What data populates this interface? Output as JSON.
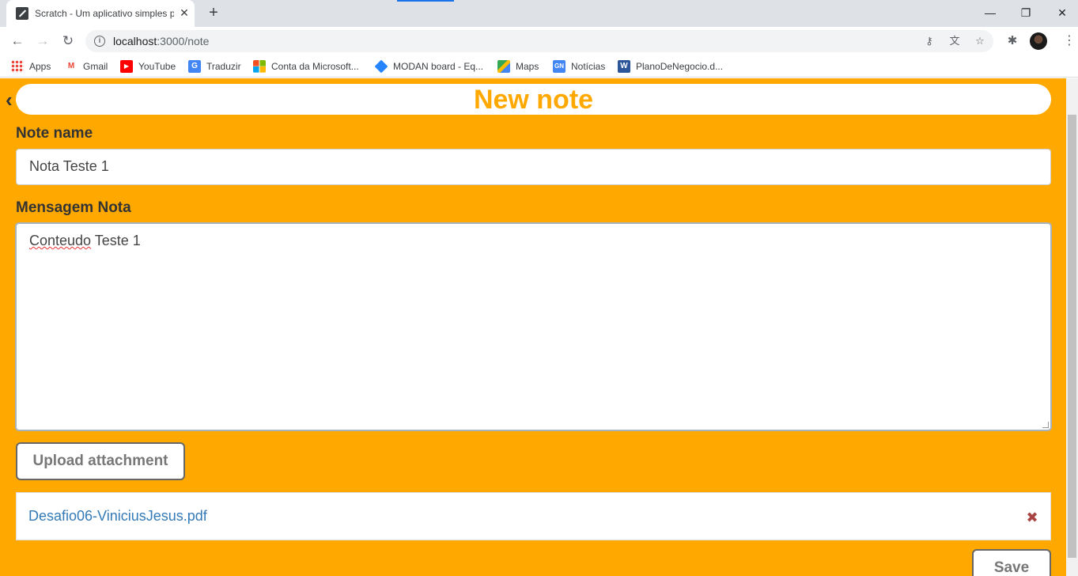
{
  "browser": {
    "tab_title": "Scratch - Um aplicativo simples p",
    "tab_close": "✕",
    "new_tab": "+",
    "url_host": "localhost",
    "url_path": ":3000/note",
    "window": {
      "minimize": "—",
      "restore": "❐",
      "close": "✕"
    },
    "nav": {
      "back": "←",
      "forward": "→",
      "reload": "↻"
    },
    "omnibox_icons": {
      "key": "⚷",
      "translate": "文",
      "star": "☆"
    },
    "extensions_icon": "✱",
    "menu": "⋮"
  },
  "bookmarks": [
    {
      "label": "Apps",
      "icon": "apps-icon",
      "color": "#1a73e8"
    },
    {
      "label": "Gmail",
      "icon": "gmail-icon",
      "color": "#ea4335"
    },
    {
      "label": "YouTube",
      "icon": "youtube-icon",
      "color": "#ff0000"
    },
    {
      "label": "Traduzir",
      "icon": "translate-icon",
      "color": "#4285f4"
    },
    {
      "label": "Conta da Microsoft...",
      "icon": "microsoft-icon",
      "color": "#f25022"
    },
    {
      "label": "MODAN board - Eq...",
      "icon": "jira-icon",
      "color": "#2684ff"
    },
    {
      "label": "Maps",
      "icon": "maps-icon",
      "color": "#34a853"
    },
    {
      "label": "Notícias",
      "icon": "news-icon",
      "color": "#4285f4"
    },
    {
      "label": "PlanoDeNegocio.d...",
      "icon": "word-icon",
      "color": "#2b579a"
    }
  ],
  "page": {
    "back_glyph": "‹",
    "title": "New note",
    "note_name_label": "Note name",
    "note_name_value": "Nota Teste 1",
    "message_label": "Mensagem Nota",
    "message_word1": "Conteudo",
    "message_rest": " Teste 1",
    "upload_label": "Upload attachment",
    "attachment_name": "Desafio06-ViniciusJesus.pdf",
    "remove_glyph": "✖",
    "save_label": "Save"
  },
  "colors": {
    "page_background": "#ffa900",
    "title_color": "#ffa900",
    "link_color": "#337ab7",
    "remove_color": "#a94442"
  }
}
